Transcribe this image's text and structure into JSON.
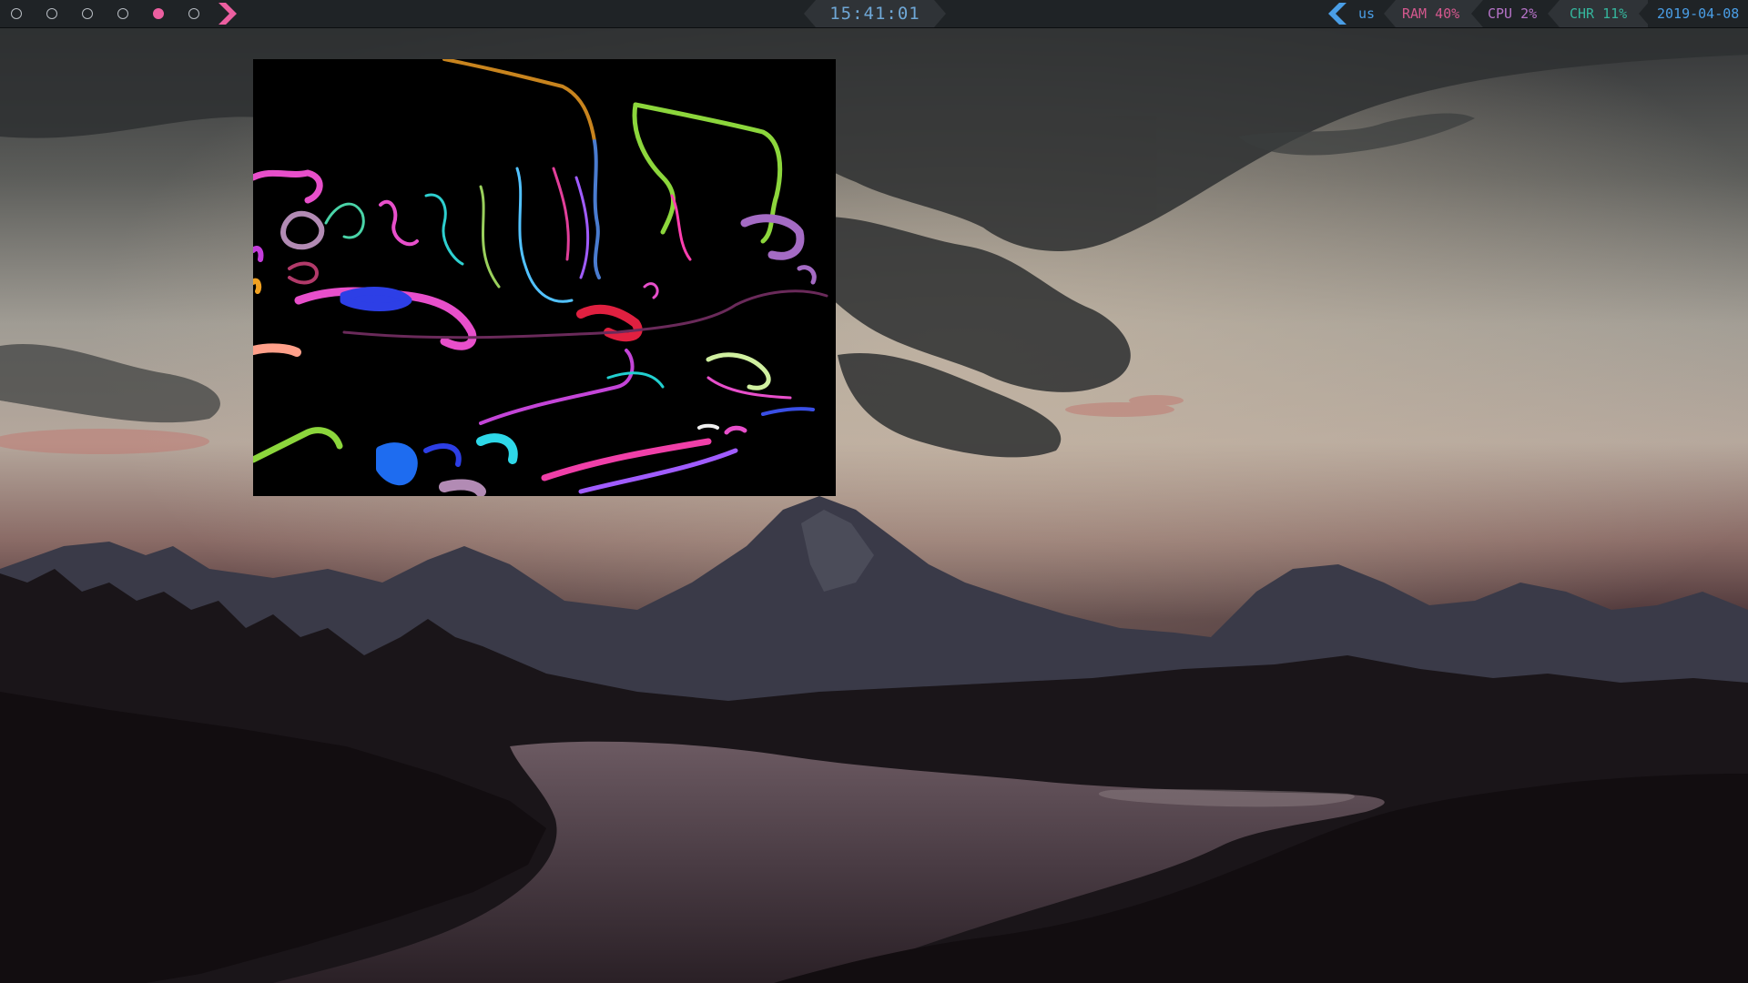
{
  "topbar": {
    "workspaces": [
      {
        "state": "empty"
      },
      {
        "state": "empty"
      },
      {
        "state": "empty"
      },
      {
        "state": "empty"
      },
      {
        "state": "active"
      },
      {
        "state": "empty"
      }
    ],
    "clock": "15:41:01",
    "keyboard_layout": "us",
    "ram": "RAM 40%",
    "cpu": "CPU 2%",
    "charge": "CHR 11%",
    "date": "2019-04-08"
  },
  "colors": {
    "bar_bg": "#1f2326",
    "segment_bg": "#2f3337",
    "accent_pink": "#ec5fa0",
    "accent_blue": "#4a9ee6",
    "clock_text": "#6fa7d6",
    "ram_text": "#d4588e",
    "cpu_text": "#b673c8",
    "charge_text": "#35b59c",
    "date_text": "#4a9ee6",
    "layout_text": "#4a9ee6"
  },
  "icons": {
    "workspace_arrow": "chevron-right-icon",
    "layout_arrow": "chevron-left-icon"
  }
}
